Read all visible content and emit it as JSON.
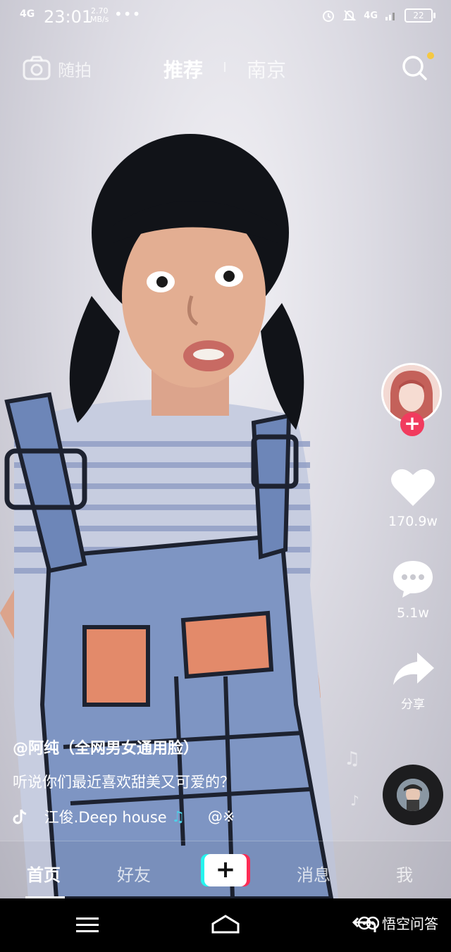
{
  "status_bar": {
    "network": "4G",
    "time": "23:01",
    "speed_value": "2.70",
    "speed_unit": "MB/s",
    "more": "•••",
    "network_right": "4G",
    "battery": "22"
  },
  "top_nav": {
    "camera_label": "随拍",
    "tab_recommend": "推荐",
    "tab_city": "南京"
  },
  "rail": {
    "likes": "170.9w",
    "comments": "5.1w",
    "share_label": "分享",
    "follow_symbol": "+"
  },
  "video": {
    "author": "@阿纯（全网男女通用脸）",
    "description": "听说你们最近喜欢甜美又可爱的？",
    "music_name": "江俊.Deep house",
    "music_handle": "@※"
  },
  "tab_bar": {
    "home": "首页",
    "friends": "好友",
    "create": "+",
    "messages": "消息",
    "me": "我"
  },
  "watermark": {
    "text": "悟空问答"
  },
  "colors": {
    "accent_red": "#fe2c55",
    "accent_cyan": "#25f4ee",
    "notification_dot": "#f5c842"
  }
}
